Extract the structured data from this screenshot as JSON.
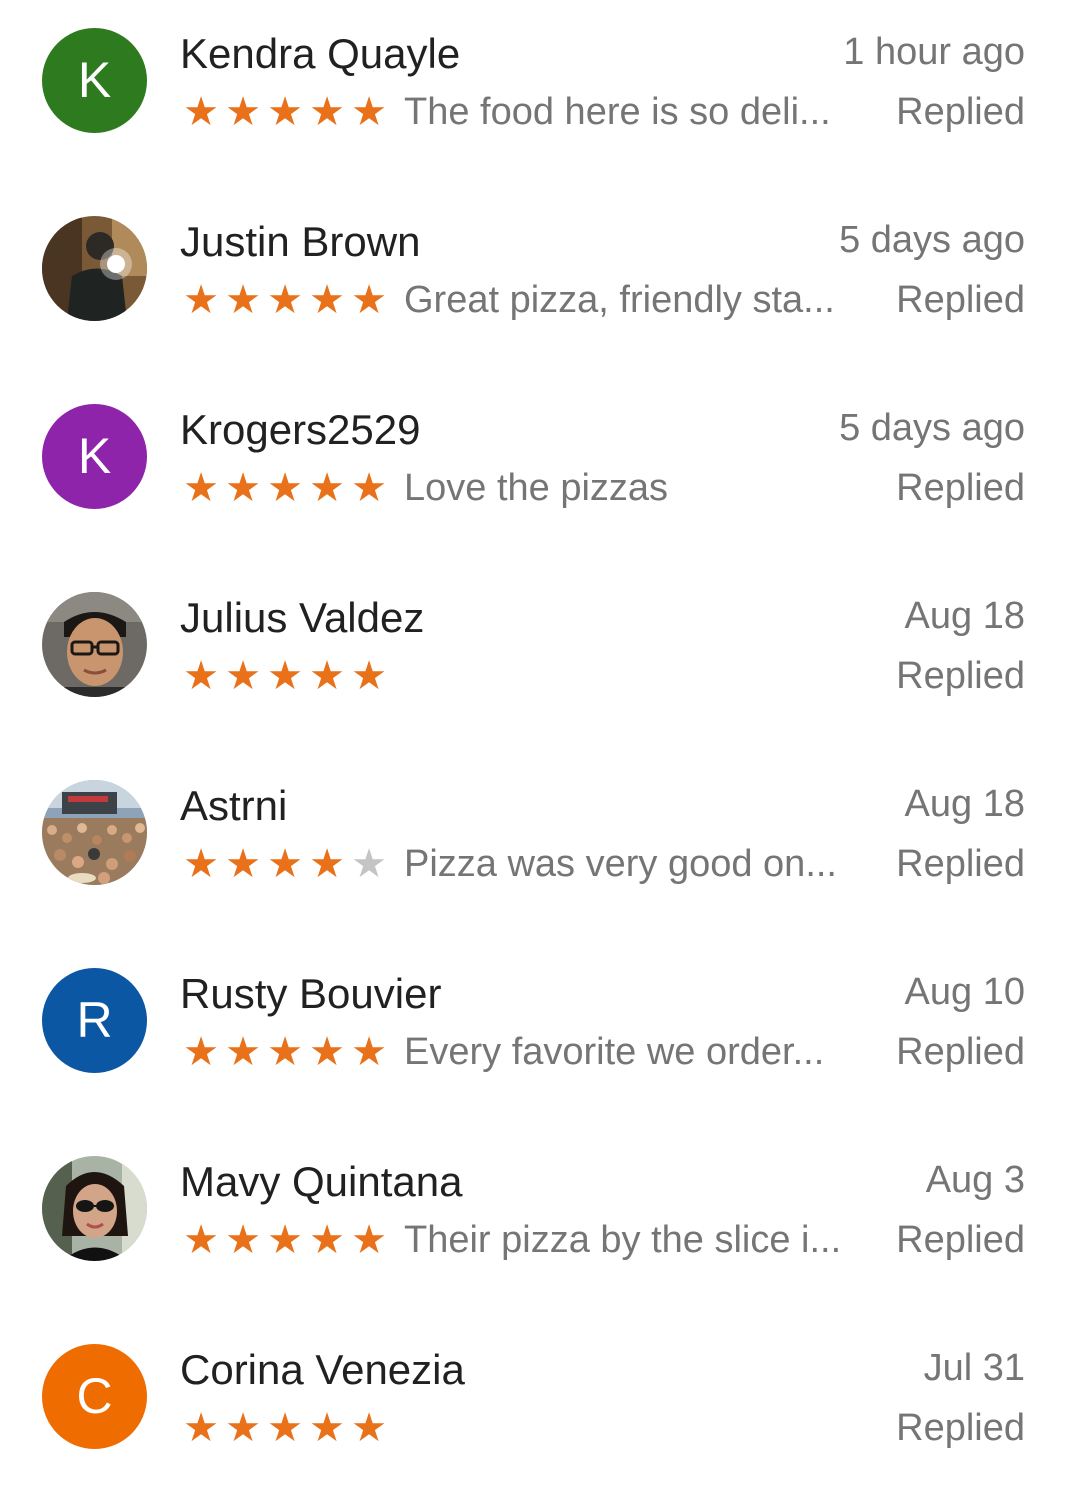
{
  "reviews": [
    {
      "name": "Kendra Quayle",
      "time": "1 hour ago",
      "rating": 5,
      "snippet": "The food here is so deli...",
      "status": "Replied",
      "avatar": {
        "kind": "letter",
        "letter": "K",
        "color": "#2e7a1f"
      }
    },
    {
      "name": "Justin Brown",
      "time": "5 days ago",
      "rating": 5,
      "snippet": "Great pizza, friendly sta...",
      "status": "Replied",
      "avatar": {
        "kind": "photo",
        "photo": "man-selfie-flash"
      }
    },
    {
      "name": "Krogers2529",
      "time": "5 days ago",
      "rating": 5,
      "snippet": "Love the pizzas",
      "status": "Replied",
      "avatar": {
        "kind": "letter",
        "letter": "K",
        "color": "#8e24aa"
      }
    },
    {
      "name": "Julius Valdez",
      "time": "Aug 18",
      "rating": 5,
      "snippet": "",
      "status": "Replied",
      "avatar": {
        "kind": "photo",
        "photo": "man-with-glasses"
      }
    },
    {
      "name": "Astrni",
      "time": "Aug 18",
      "rating": 4,
      "snippet": "Pizza was very good on...",
      "status": "Replied",
      "avatar": {
        "kind": "photo",
        "photo": "concert-crowd"
      }
    },
    {
      "name": "Rusty Bouvier",
      "time": "Aug 10",
      "rating": 5,
      "snippet": "Every favorite we order...",
      "status": "Replied",
      "avatar": {
        "kind": "letter",
        "letter": "R",
        "color": "#0b57a4"
      }
    },
    {
      "name": "Mavy Quintana",
      "time": "Aug 3",
      "rating": 5,
      "snippet": "Their pizza by the slice i...",
      "status": "Replied",
      "avatar": {
        "kind": "photo",
        "photo": "woman-sunglasses"
      }
    },
    {
      "name": "Corina Venezia",
      "time": "Jul 31",
      "rating": 5,
      "snippet": "",
      "status": "Replied",
      "avatar": {
        "kind": "letter",
        "letter": "C",
        "color": "#ef6c00"
      }
    }
  ],
  "colors": {
    "star_filled": "#e8711a",
    "star_empty": "#c4c4c4",
    "name_text": "#212121",
    "meta_text": "#757575"
  }
}
